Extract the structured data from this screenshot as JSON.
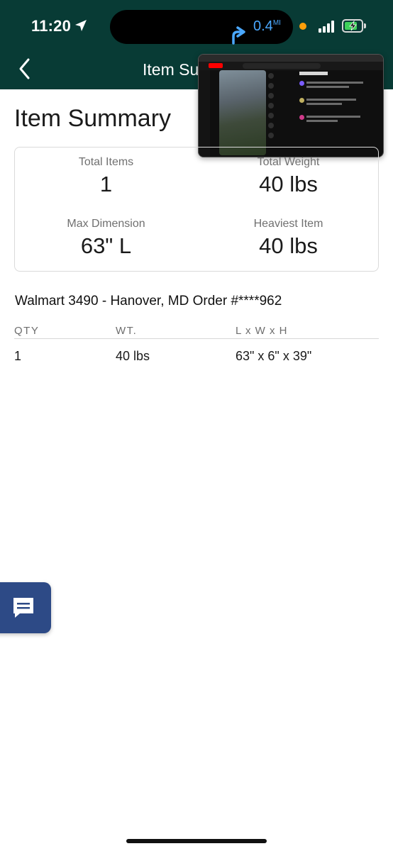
{
  "status_bar": {
    "time": "11:20",
    "distance_value": "0.4",
    "distance_unit": "MI"
  },
  "header": {
    "title": "Item Summary",
    "back_icon": "chevron-left-icon"
  },
  "pip": {
    "search_text": "gameboy power pack",
    "comments_label": "Comments"
  },
  "page": {
    "title": "Item Summary"
  },
  "summary": {
    "total_items_label": "Total Items",
    "total_items_value": "1",
    "total_weight_label": "Total Weight",
    "total_weight_value": "40 lbs",
    "max_dimension_label": "Max Dimension",
    "max_dimension_value": "63\" L",
    "heaviest_item_label": "Heaviest Item",
    "heaviest_item_value": "40 lbs"
  },
  "order": {
    "title": "Walmart 3490 - Hanover, MD Order #****962",
    "columns": [
      "QTY",
      "WT.",
      "L x W x H"
    ],
    "rows": [
      [
        "1",
        "40 lbs",
        "63\" x 6\" x 39\""
      ]
    ]
  },
  "colors": {
    "header_bg": "#083b35",
    "chat_button_bg": "#2d4a86",
    "distance_text": "#4aa8ff"
  },
  "icons": {
    "chat": "chat-bubble-icon",
    "navigation": "navigation-arrow-icon",
    "location": "location-arrow-icon"
  }
}
